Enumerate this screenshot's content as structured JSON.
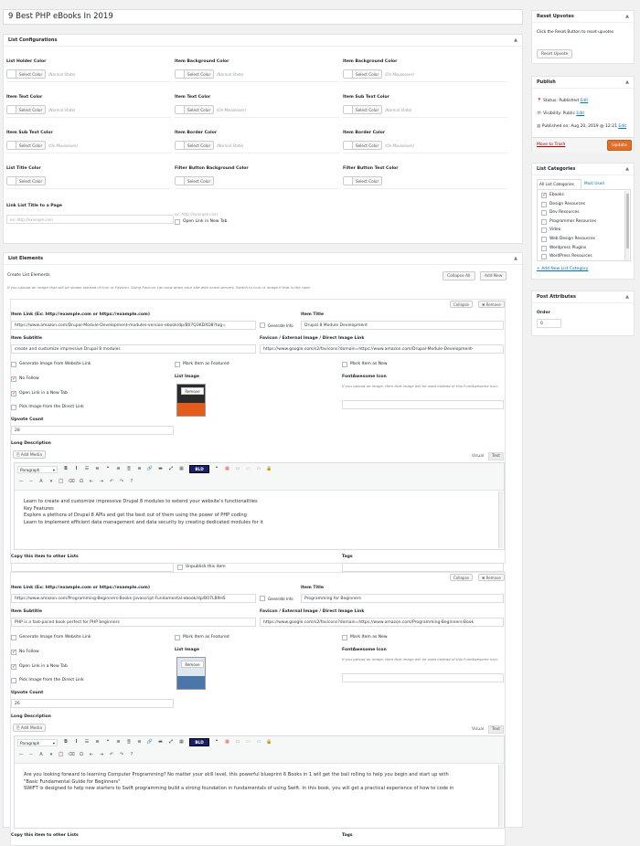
{
  "post_title": "9 Best PHP eBooks In 2019",
  "list_config": {
    "heading": "List Configurations",
    "fields": [
      {
        "label": "List Holder Color",
        "button": "Select Color",
        "note": "(Normal State)"
      },
      {
        "label": "Item Background Color",
        "button": "Select Color",
        "note": "(Normal State)"
      },
      {
        "label": "Item Background Color",
        "button": "Select Color",
        "note": "(On Mouseover)"
      },
      {
        "label": "Item Text Color",
        "button": "Select Color",
        "note": "(Normal State)"
      },
      {
        "label": "Item Text Color",
        "button": "Select Color",
        "note": "(On Mouseover)"
      },
      {
        "label": "Item Sub Text Color",
        "button": "Select Color",
        "note": "(Normal State)"
      },
      {
        "label": "Item Sub Text Color",
        "button": "Select Color",
        "note": "(On Mouseover)"
      },
      {
        "label": "Item Border Color",
        "button": "Select Color",
        "note": "(Normal State)"
      },
      {
        "label": "Item Border Color",
        "button": "Select Color",
        "note": "(On Mouseover)"
      },
      {
        "label": "List Title Color",
        "button": "Select Color",
        "note": ""
      },
      {
        "label": "Filter Button Background Color",
        "button": "Select Color",
        "note": ""
      },
      {
        "label": "Filter Button Text Color",
        "button": "Select Color",
        "note": ""
      }
    ],
    "link_title_label": "Link List Title to a Page",
    "link_placeholder": "ex: http://example.com",
    "link_placeholder2": "ex: http://example.com",
    "open_new_tab": "Open Link in New Tab"
  },
  "list_elements": {
    "heading": "List Elements",
    "create_label": "Create List Elements",
    "collapse_all": "Collapse All",
    "add_new": "Add New",
    "info": "If you upload an image that will be shown instead of Icon or Favicon. Using Favicon can slow down your site with some servers. Switch to icon or image if that is the case.",
    "items": [
      {
        "collapse": "Collapse",
        "remove": "✖ Remove",
        "link_label": "Item Link (Ex: http://example.com or https://example.com)",
        "link_value": "https://www.amazon.com/Drupal-Module-Development-modules-version-ebook/dp/B07Q3KDXD8?tag=",
        "generate_info": "Generate Info",
        "title_label": "Item Title",
        "title_value": "Drupal 8 Module Development",
        "subtitle_label": "Item Subtitle",
        "subtitle_value": "create and customize impressive Drupal 8 modules",
        "favicon_label": "Favicon / External Image / Direct Image Link",
        "favicon_value": "https://www.google.com/s2/favicons?domain=https://www.amazon.com/Drupal-Module-Development-",
        "gen_image": "Generate Image from Website Link",
        "featured": "Mark Item as Featured",
        "mark_new": "Mark Item as New",
        "no_follow": "No Follow",
        "list_image": "List Image",
        "fa_icon": "FontAwesome Icon",
        "fa_note": "If you upload an image, then that image will be used instead of this FontAwesome icon.",
        "open_new_tab": "Open Link in a New Tab",
        "pick_image": "Pick Image from the Direct Link",
        "image_remove": "Remove",
        "upvote_label": "Upvote Count",
        "upvote_value": "28",
        "long_desc_label": "Long Description",
        "add_media": "Add Media",
        "visual_tab": "Visual",
        "text_tab": "Text",
        "paragraph": "Paragraph",
        "content": [
          "Learn to create and customize impressive Drupal 8 modules to extend your website's functionalities",
          "Key Features",
          "Explore a plethora of Drupal 8 APIs and get the best out of them using the power of PHP coding",
          "Learn to implement efficient data management and data security by creating dedicated modules for it"
        ],
        "copy_label": "Copy this item to other Lists",
        "unpublish": "Unpublish this item",
        "tags_label": "Tags"
      },
      {
        "collapse": "Collapse",
        "remove": "✖ Remove",
        "link_label": "Item Link (Ex: http://example.com or https://example.com)",
        "link_value": "https://www.amazon.com/Programming-Beginners-Books-Javascript-Fundamental-ebook/dp/B07LB9HS",
        "generate_info": "Generate Info",
        "title_label": "Item Title",
        "title_value": "Programming for Beginners",
        "subtitle_label": "Item Subtitle",
        "subtitle_value": "PHP is a fast-paced book perfect for PHP beginners",
        "favicon_label": "Favicon / External Image / Direct Image Link",
        "favicon_value": "https://www.google.com/s2/favicons?domain=https://www.amazon.com/Programming-Beginners-Book",
        "gen_image": "Generate Image from Website Link",
        "featured": "Mark Item as Featured",
        "mark_new": "Mark Item as New",
        "no_follow": "No Follow",
        "list_image": "List Image",
        "fa_icon": "FontAwesome Icon",
        "fa_note": "If you upload an image, then that image will be used instead of this FontAwesome icon.",
        "open_new_tab": "Open Link in a New Tab",
        "pick_image": "Pick Image from the Direct Link",
        "image_remove": "Remove",
        "upvote_label": "Upvote Count",
        "upvote_value": "26",
        "long_desc_label": "Long Description",
        "add_media": "Add Media",
        "visual_tab": "Visual",
        "text_tab": "Text",
        "paragraph": "Paragraph",
        "content": [
          "Are you looking forward to learning Computer Programming? No matter your skill level, this powerful blueprint 6 Books in 1 will get the ball rolling to help you begin and start up with",
          "\"Basic Fundamental Guide for Beginners\"",
          "SWIFT is designed to help new starters to Swift programming build a strong foundation in fundamentals of using Swift. In this book, you will get a practical experience of how to code in"
        ],
        "copy_label": "Copy this item to other Lists",
        "tags_label": "Tags"
      }
    ]
  },
  "sidebar": {
    "reset": {
      "heading": "Reset Upvotes",
      "text": "Click the Reset Button to reset upvotes",
      "button": "Reset Upvote"
    },
    "publish": {
      "heading": "Publish",
      "status": "Status: Published",
      "visibility": "Visibility: Public",
      "published_on": "Published on: Aug 20, 2019 @ 12:21",
      "edit": "Edit",
      "trash": "Move to Trash",
      "update": "Update"
    },
    "categories": {
      "heading": "List Categories",
      "tab_all": "All List Categories",
      "tab_used": "Most Used",
      "items": [
        "Ebooks",
        "Design Resources",
        "Dev Resources",
        "Programmer Resources",
        "Video",
        "Web Design Resources",
        "Wordpress Plugins",
        "WordPress Resources"
      ],
      "add_new": "+ Add New List Category"
    },
    "attributes": {
      "heading": "Post Attributes",
      "order_label": "Order",
      "order_value": "0"
    }
  },
  "colors": {
    "accent": "#0073aa",
    "trash": "#a00",
    "update": "#e26f29"
  }
}
